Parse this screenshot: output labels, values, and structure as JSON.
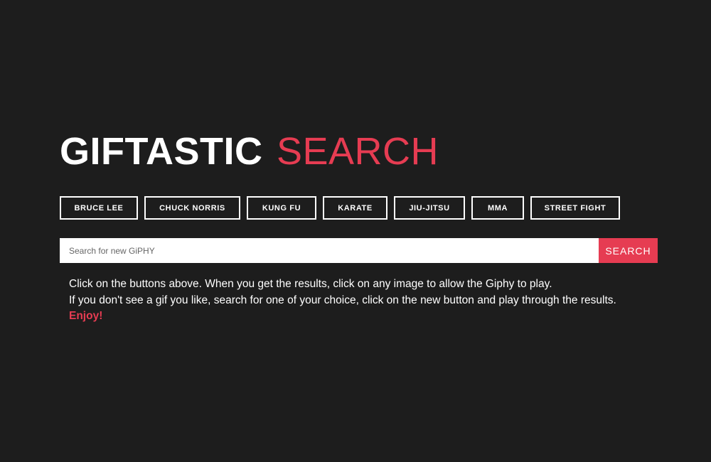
{
  "header": {
    "title_bold": "GIFTASTIC",
    "title_light": "SEARCH"
  },
  "topics": [
    "BRUCE LEE",
    "CHUCK NORRIS",
    "KUNG FU",
    "KARATE",
    "JIU-JITSU",
    "MMA",
    "STREET FIGHT"
  ],
  "search": {
    "value": "",
    "placeholder": "Search for new GiPHY",
    "button_label": "SEARCH"
  },
  "instructions": {
    "line1": "Click on the buttons above. When you get the results, click on any image to allow the Giphy to play.",
    "line2": "If you don't see a gif you like, search for one of your choice, click on the new button and play through the results.",
    "enjoy": "Enjoy!"
  },
  "colors": {
    "background": "#1d1d1d",
    "accent": "#e63c52",
    "text": "#ffffff"
  }
}
